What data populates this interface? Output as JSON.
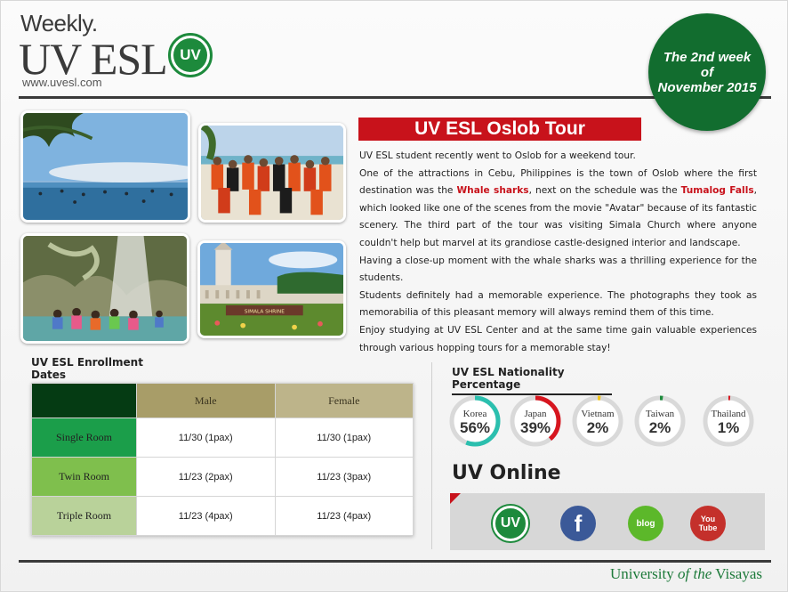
{
  "header": {
    "weekly": "Weekly.",
    "brand": "UV ESL",
    "logo_text": "UV",
    "url": "www.uvesl.com",
    "week_line1": "The 2nd week",
    "week_line2": "of",
    "week_line3": "November 2015"
  },
  "article": {
    "title": "UV ESL Oslob Tour",
    "p1": "UV ESL student recently went to Oslob for a weekend tour.",
    "p2_a": "One of the attractions in Cebu, Philippines is the town of Oslob where the first destination was the ",
    "p2_hl1": "Whale sharks",
    "p2_b": ", next on the schedule was the ",
    "p2_hl2": "Tumalog Falls",
    "p2_c": ", which looked like one of the scenes from the movie \"Avatar\" because of its fantastic scenery. The third part of the tour was visiting Simala Church where anyone couldn't help but marvel at its grandiose castle-designed interior and landscape.",
    "p3": "Having a close-up moment with the whale sharks was a thrilling experience  for the students.",
    "p4": "Students definitely had a memorable experience. The photographs they took as memorabilia of this pleasant memory will always remind them of this time.",
    "p5": "Enjoy studying at UV ESL Center and at the same time gain valuable experiences through various hopping tours for a memorable stay!"
  },
  "photos": {
    "photo_3_sign": "SIMALA SHRINE"
  },
  "enrollment": {
    "heading": "UV ESL Enrollment Dates",
    "columns": [
      "",
      "Male",
      "Female"
    ],
    "rows": [
      {
        "room": "Single Room",
        "male": "11/30 (1pax)",
        "female": "11/30 (1pax)"
      },
      {
        "room": "Twin Room",
        "male": "11/23 (2pax)",
        "female": "11/23 (3pax)"
      },
      {
        "room": "Triple Room",
        "male": "11/23 (4pax)",
        "female": "11/23 (4pax)"
      }
    ]
  },
  "nationality": {
    "heading": "UV ESL Nationality Percentage",
    "items": [
      {
        "country": "Korea",
        "label": "56%",
        "value": 56,
        "color": "#2bbfae"
      },
      {
        "country": "Japan",
        "label": "39%",
        "value": 39,
        "color": "#d7161f"
      },
      {
        "country": "Vietnam",
        "label": "2%",
        "value": 2,
        "color": "#f0c419"
      },
      {
        "country": "Taiwan",
        "label": "2%",
        "value": 2,
        "color": "#1d8a3c"
      },
      {
        "country": "Thailand",
        "label": "1%",
        "value": 1,
        "color": "#d7161f"
      }
    ]
  },
  "online": {
    "heading": "UV Online",
    "icons": [
      {
        "name": "uv-icon",
        "text": "UV",
        "color": "#1d8a3c"
      },
      {
        "name": "facebook-icon",
        "text": "f",
        "color": "#3b5998"
      },
      {
        "name": "blog-icon",
        "text": "blog",
        "color": "#5cb82a"
      },
      {
        "name": "youtube-icon",
        "text": "You Tube",
        "color": "#c4302b"
      }
    ]
  },
  "footer": {
    "left": "University ",
    "of_the": "of the",
    "right": " Visayas"
  }
}
